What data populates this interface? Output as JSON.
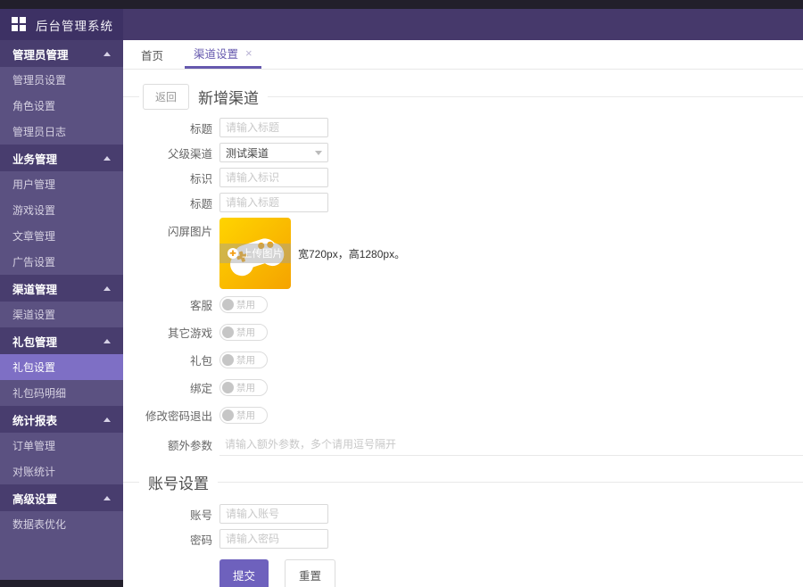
{
  "app": {
    "title": "后台管理系统"
  },
  "icons": {
    "close": "×",
    "upload": "✚"
  },
  "colors": {
    "topbar": "#221f2b",
    "header": "#46396b",
    "logo_bg": "#3d3164",
    "sidebar": "#5b5181",
    "sidebar_section": "#483d6e",
    "sidebar_active": "#7e6fc5",
    "accent": "#6e61bd",
    "tab_active": "#6659ae",
    "upload_gradient_from": "#ffd400",
    "upload_gradient_to": "#f5a300"
  },
  "sidebar": {
    "rows": [
      {
        "label": "管理员管理",
        "type": "section"
      },
      {
        "label": "管理员设置"
      },
      {
        "label": "角色设置"
      },
      {
        "label": "管理员日志"
      },
      {
        "label": "业务管理",
        "type": "section"
      },
      {
        "label": "用户管理"
      },
      {
        "label": "游戏设置"
      },
      {
        "label": "文章管理"
      },
      {
        "label": "广告设置"
      },
      {
        "label": "渠道管理",
        "type": "section"
      },
      {
        "label": "渠道设置"
      },
      {
        "label": "礼包管理",
        "type": "section"
      },
      {
        "label": "礼包设置",
        "active": true
      },
      {
        "label": "礼包码明细"
      },
      {
        "label": "统计报表",
        "type": "section"
      },
      {
        "label": "订单管理"
      },
      {
        "label": "对账统计"
      },
      {
        "label": "高级设置",
        "type": "section"
      },
      {
        "label": "数据表优化"
      }
    ]
  },
  "tabs": [
    {
      "label": "首页"
    },
    {
      "label": "渠道设置",
      "active": true
    }
  ],
  "page": {
    "back_label": "返回",
    "title": "新增渠道",
    "account_section_title": "账号设置"
  },
  "form": {
    "title1": {
      "label": "标题",
      "placeholder": "请输入标题"
    },
    "parent_channel": {
      "label": "父级渠道",
      "value": "测试渠道"
    },
    "identifier": {
      "label": "标识",
      "placeholder": "请输入标识"
    },
    "title2": {
      "label": "标题",
      "placeholder": "请输入标题"
    },
    "splash": {
      "label": "闪屏图片",
      "upload_text": "上传图片",
      "hint": "宽720px，高1280px。"
    },
    "toggles": [
      {
        "label": "客服",
        "state": "禁用"
      },
      {
        "label": "其它游戏",
        "state": "禁用"
      },
      {
        "label": "礼包",
        "state": "禁用"
      },
      {
        "label": "绑定",
        "state": "禁用"
      },
      {
        "label": "修改密码退出",
        "state": "禁用"
      }
    ],
    "extra_params": {
      "label": "额外参数",
      "placeholder": "请输入额外参数，多个请用逗号隔开"
    },
    "account": {
      "label": "账号",
      "placeholder": "请输入账号"
    },
    "password": {
      "label": "密码",
      "placeholder": "请输入密码"
    },
    "submit_label": "提交",
    "reset_label": "重置"
  }
}
